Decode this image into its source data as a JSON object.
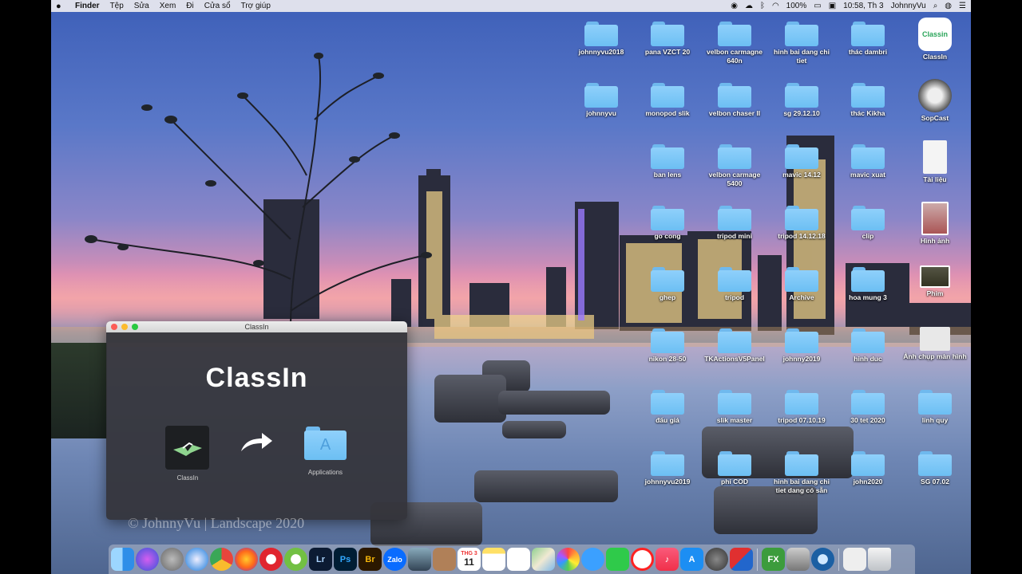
{
  "menubar": {
    "apple": "",
    "items": [
      "Finder",
      "Tệp",
      "Sửa",
      "Xem",
      "Đi",
      "Cửa sổ",
      "Trợ giúp"
    ],
    "battery": "100%",
    "clock": "10:58, Th 3",
    "user": "JohnnyVu"
  },
  "desktop": {
    "folders": [
      {
        "label": "johnnyvu2018"
      },
      {
        "label": "pana VZCT 20"
      },
      {
        "label": "velbon carmagne 640n"
      },
      {
        "label": "hinh bai dang chi tiet"
      },
      {
        "label": "thác dambri"
      },
      {
        "label": "johnnyvu"
      },
      {
        "label": "monopod slik"
      },
      {
        "label": "velbon chaser II"
      },
      {
        "label": "sg 29.12.10"
      },
      {
        "label": "thác Kikha"
      },
      {
        "label": "ban lens"
      },
      {
        "label": "velbon carmage 5400"
      },
      {
        "label": "mavic 14.12"
      },
      {
        "label": "mavic xuat"
      },
      {
        "label": "go cong"
      },
      {
        "label": "tripod mini"
      },
      {
        "label": "tripod 14.12.18"
      },
      {
        "label": "clip"
      },
      {
        "label": "ghep"
      },
      {
        "label": "tripod"
      },
      {
        "label": "Archive"
      },
      {
        "label": "hoa mung 3"
      },
      {
        "label": "nikon 28-50"
      },
      {
        "label": "TKActionsV5Panel"
      },
      {
        "label": "johnny2019"
      },
      {
        "label": "hinh duc"
      },
      {
        "label": "đấu giá"
      },
      {
        "label": "slik master"
      },
      {
        "label": "tripod 07.10.19"
      },
      {
        "label": "30 tet 2020"
      },
      {
        "label": "linh quy"
      },
      {
        "label": "johnnyvu2019"
      },
      {
        "label": "phí COD"
      },
      {
        "label": "hinh bai dang chi tiet dang có sẵn"
      },
      {
        "label": "john2020"
      },
      {
        "label": "SG 07.02"
      }
    ],
    "apps": [
      {
        "label": "ClassIn"
      },
      {
        "label": "SopCast"
      },
      {
        "label": "Tài liệu"
      },
      {
        "label": "Hình ảnh"
      },
      {
        "label": "Phim"
      },
      {
        "label": "Ảnh chụp màn hình"
      }
    ]
  },
  "installer": {
    "title": "ClassIn",
    "logo": "ClassIn",
    "app_label": "ClassIn",
    "folder_label": "Applications"
  },
  "watermark": "© JohnnyVu | Landscape 2020",
  "dock": {
    "items": [
      "Finder",
      "Siri",
      "Launchpad",
      "Safari",
      "Chrome",
      "Firefox",
      "Opera",
      "Coc Coc",
      "Lr",
      "Ps",
      "Br",
      "Zalo",
      "Preview",
      "Contacts",
      "Calendar",
      "Notes",
      "Reminders",
      "Maps",
      "Photos",
      "Messages",
      "FaceTime",
      "News",
      "Music",
      "App Store",
      "System Preferences",
      "Parallels",
      "FX",
      "Photos Browser",
      "QuickTime",
      "Downloads",
      "Trash"
    ],
    "calendar_month": "THG 3",
    "calendar_day": "11"
  }
}
